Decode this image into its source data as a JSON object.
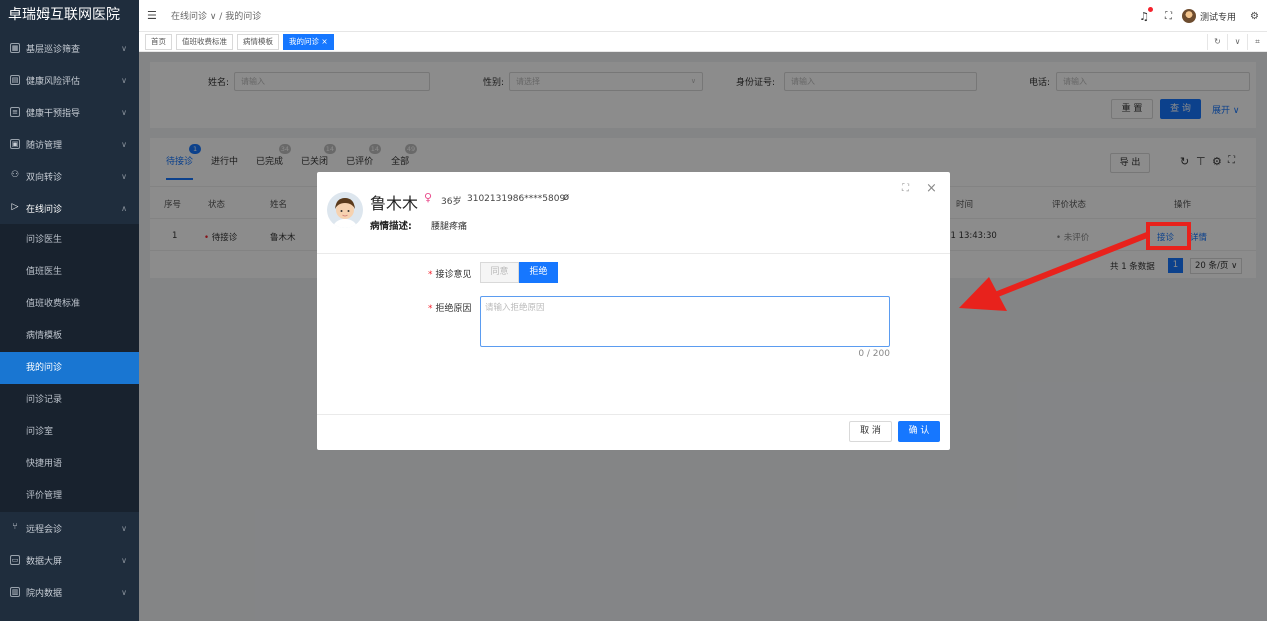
{
  "brand": "卓瑞姆互联网医院",
  "sidebar": {
    "items": [
      {
        "label": "基层巡诊筛查",
        "icon": "grid-icon"
      },
      {
        "label": "健康风险评估",
        "icon": "doc-icon"
      },
      {
        "label": "健康干预指导",
        "icon": "list-icon"
      },
      {
        "label": "随访管理",
        "icon": "calendar-icon"
      },
      {
        "label": "双向转诊",
        "icon": "user-icon"
      },
      {
        "label": "在线问诊",
        "icon": "play-icon"
      }
    ],
    "sub_items": [
      "问诊医生",
      "值班医生",
      "值班收费标准",
      "病情模板",
      "我的问诊",
      "问诊记录",
      "问诊室",
      "快捷用语",
      "评价管理"
    ],
    "bottom_items": [
      {
        "label": "远程会诊",
        "icon": "branch-icon"
      },
      {
        "label": "数据大屏",
        "icon": "screen-icon"
      },
      {
        "label": "院内数据",
        "icon": "table-icon"
      }
    ]
  },
  "header": {
    "breadcrumb": "在线问诊 ∨ / 我的问诊",
    "user": "测试专用"
  },
  "tabs": [
    "首页",
    "值班收费标准",
    "病情模板",
    "我的问诊 ×"
  ],
  "search": {
    "name_label": "姓名:",
    "name_placeholder": "请输入",
    "gender_label": "性别:",
    "gender_placeholder": "请选择",
    "idcard_label": "身份证号:",
    "idcard_placeholder": "请输入",
    "phone_label": "电话:",
    "phone_placeholder": "请输入",
    "reset": "重 置",
    "query": "查 询",
    "expand": "展开 ∨"
  },
  "status_tabs": [
    {
      "label": "待接诊",
      "badge": "1"
    },
    {
      "label": "进行中",
      "badge": ""
    },
    {
      "label": "已完成",
      "badge": "34"
    },
    {
      "label": "已关闭",
      "badge": "14"
    },
    {
      "label": "已评价",
      "badge": "14"
    },
    {
      "label": "全部",
      "badge": "49"
    }
  ],
  "toolbar": {
    "export": "导 出"
  },
  "table": {
    "headers": [
      "序号",
      "状态",
      "姓名",
      "时间",
      "评价状态",
      "操作"
    ],
    "row": {
      "index": "1",
      "status": "待接诊",
      "name": "鲁木木",
      "time": "-11 13:43:30",
      "eval": "未评价",
      "action_accept": "接诊",
      "action_detail": "详情"
    },
    "total": "共 1 条数据",
    "page": "1",
    "page_size": "20 条/页 ∨"
  },
  "modal": {
    "name": "鲁木木",
    "age": "36岁",
    "id_masked": "3102131986****5809",
    "desc_label": "病情描述:",
    "desc_value": "腰腿疼痛",
    "opinion_label": "接诊意见",
    "agree": "同意",
    "reject": "拒绝",
    "reason_label": "拒绝原因",
    "reason_placeholder": "请输入拒绝原因",
    "counter": "0 / 200",
    "cancel": "取 消",
    "confirm": "确 认"
  },
  "colors": {
    "primary": "#1677ff",
    "sidebar_bg": "#1f2d3d",
    "annotation": "#e8221c"
  }
}
